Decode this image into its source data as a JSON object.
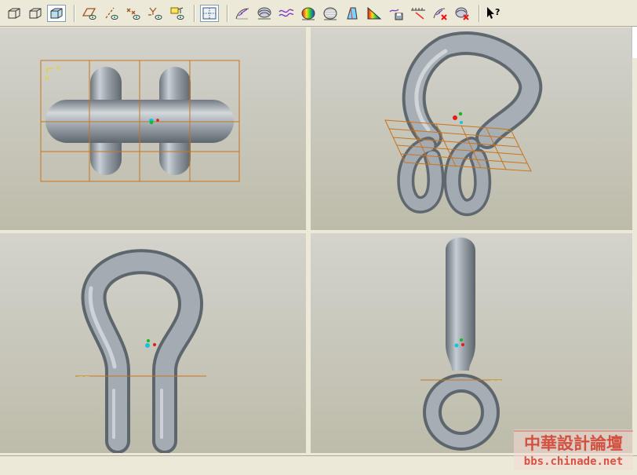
{
  "toolbar": {
    "items": [
      {
        "icon": "wireframe-cube-icon"
      },
      {
        "icon": "hidden-line-cube-icon"
      },
      {
        "icon": "shaded-cube-icon",
        "pressed": true
      },
      {
        "icon": "datum-plane-display-icon"
      },
      {
        "icon": "datum-axis-display-icon"
      },
      {
        "icon": "point-display-icon"
      },
      {
        "icon": "coordinate-system-display-icon"
      },
      {
        "icon": "annotation-display-icon"
      },
      {
        "icon": "multi-view-icon",
        "pressed": true
      },
      {
        "icon": "curvature-analysis-icon"
      },
      {
        "icon": "section-analysis-icon"
      },
      {
        "icon": "offset-analysis-icon"
      },
      {
        "icon": "shaded-curvature-icon"
      },
      {
        "icon": "reflection-analysis-icon"
      },
      {
        "icon": "draft-analysis-icon"
      },
      {
        "icon": "slope-analysis-icon"
      },
      {
        "icon": "save-analysis-icon"
      },
      {
        "icon": "measure-analysis-icon"
      },
      {
        "icon": "delete-all-curvature-icon"
      },
      {
        "icon": "delete-all-sections-icon"
      },
      {
        "icon": "context-help-icon"
      }
    ]
  },
  "views": {
    "top_left": {
      "name": "front-view"
    },
    "top_right": {
      "name": "isometric-view"
    },
    "bottom_left": {
      "name": "side-view"
    },
    "bottom_right": {
      "name": "edge-view"
    }
  },
  "datum": {
    "plane_label_h": "H",
    "plane_label_v": "V"
  },
  "watermark": {
    "line1": "中華設計論壇",
    "line2": "bbs.chinade.net",
    "color": "#d23b2a"
  },
  "colors": {
    "datum_plane": "#c8741e",
    "model_body": "#9aa3aa",
    "csys_red": "#e21b1b",
    "csys_green": "#19b524",
    "csys_cyan": "#14c4d8"
  }
}
